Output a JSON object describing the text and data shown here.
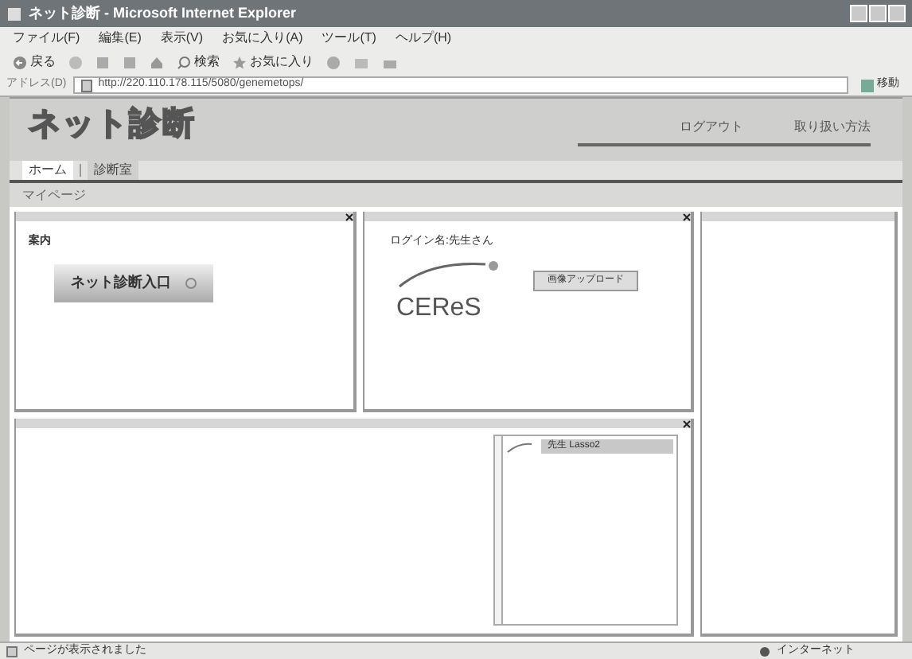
{
  "window": {
    "title": "ネット診断 - Microsoft Internet Explorer"
  },
  "menu": [
    "ファイル(F)",
    "編集(E)",
    "表示(V)",
    "お気に入り(A)",
    "ツール(T)",
    "ヘルプ(H)"
  ],
  "toolbar": {
    "back": "戻る",
    "search": "検索",
    "favorites": "お気に入り"
  },
  "address": {
    "label": "アドレス(D)",
    "value": "http://220.110.178.115/5080/genemetops/",
    "go": "移動"
  },
  "site": {
    "title": "ネット診断",
    "links": [
      "ログアウト",
      "取り扱い方法"
    ],
    "breadcrumb": [
      "ホーム",
      "診断室"
    ],
    "tab": "マイページ"
  },
  "guide": {
    "heading": "案内",
    "button": "ネット診断入口"
  },
  "login": {
    "text": "ログイン名:先生さん",
    "logo": "CEReS",
    "button": "画像アップロード"
  },
  "list": {
    "items": [
      {
        "label": "先生 Lasso2",
        "selected": true
      }
    ]
  },
  "status_bar": {
    "text": "ページが表示されました",
    "zone": "インターネット"
  }
}
